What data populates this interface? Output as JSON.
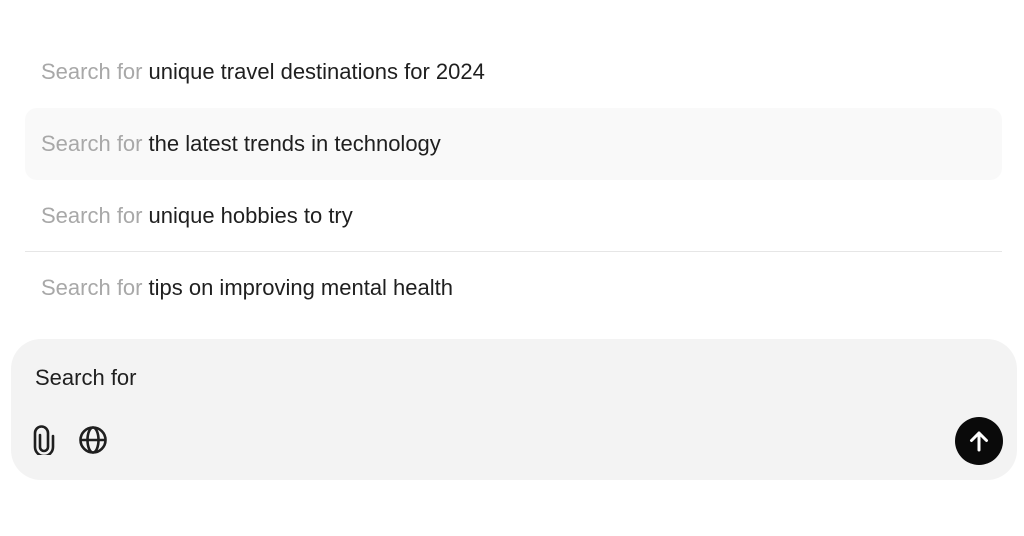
{
  "suggestions": {
    "prefix": "Search for",
    "items": [
      {
        "query": "unique travel destinations for 2024"
      },
      {
        "query": "the latest trends in technology"
      },
      {
        "query": "unique hobbies to try"
      },
      {
        "query": "tips on improving mental health"
      }
    ]
  },
  "composer": {
    "value": "Search for",
    "attach_icon": "paperclip-icon",
    "web_icon": "globe-icon",
    "send_icon": "arrow-up-icon"
  },
  "colors": {
    "prefix_text": "#a8a8a8",
    "highlight_bg": "#f9f9f9",
    "composer_bg": "#f3f3f3",
    "send_bg": "#0a0a0a"
  }
}
